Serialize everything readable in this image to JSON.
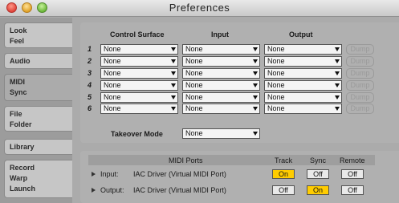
{
  "window": {
    "title": "Preferences"
  },
  "tabs": [
    {
      "line1": "Look",
      "line2": "Feel"
    },
    {
      "line1": "Audio",
      "line2": ""
    },
    {
      "line1": "MIDI",
      "line2": "Sync"
    },
    {
      "line1": "File",
      "line2": "Folder"
    },
    {
      "line1": "Library",
      "line2": ""
    },
    {
      "line1": "Record",
      "line2": "Warp",
      "line3": "Launch"
    }
  ],
  "midi": {
    "headers": {
      "control_surface": "Control Surface",
      "input": "Input",
      "output": "Output"
    },
    "rows": [
      {
        "num": "1",
        "cs": "None",
        "input": "None",
        "output": "None",
        "dump": "Dump"
      },
      {
        "num": "2",
        "cs": "None",
        "input": "None",
        "output": "None",
        "dump": "Dump"
      },
      {
        "num": "3",
        "cs": "None",
        "input": "None",
        "output": "None",
        "dump": "Dump"
      },
      {
        "num": "4",
        "cs": "None",
        "input": "None",
        "output": "None",
        "dump": "Dump"
      },
      {
        "num": "5",
        "cs": "None",
        "input": "None",
        "output": "None",
        "dump": "Dump"
      },
      {
        "num": "6",
        "cs": "None",
        "input": "None",
        "output": "None",
        "dump": "Dump"
      }
    ],
    "takeover": {
      "label": "Takeover Mode",
      "value": "None"
    },
    "ports_header": {
      "ports": "MIDI Ports",
      "track": "Track",
      "sync": "Sync",
      "remote": "Remote"
    },
    "ports": [
      {
        "direction": "Input:",
        "name": "IAC Driver (Virtual MIDI Port)",
        "track": "On",
        "sync": "Off",
        "remote": "Off",
        "track_on": true,
        "sync_on": false,
        "remote_on": false
      },
      {
        "direction": "Output:",
        "name": "IAC Driver (Virtual MIDI Port)",
        "track": "Off",
        "sync": "On",
        "remote": "Off",
        "track_on": false,
        "sync_on": true,
        "remote_on": false
      }
    ]
  },
  "colors": {
    "on": "#ffcc00",
    "off": "#e9e9e9"
  }
}
